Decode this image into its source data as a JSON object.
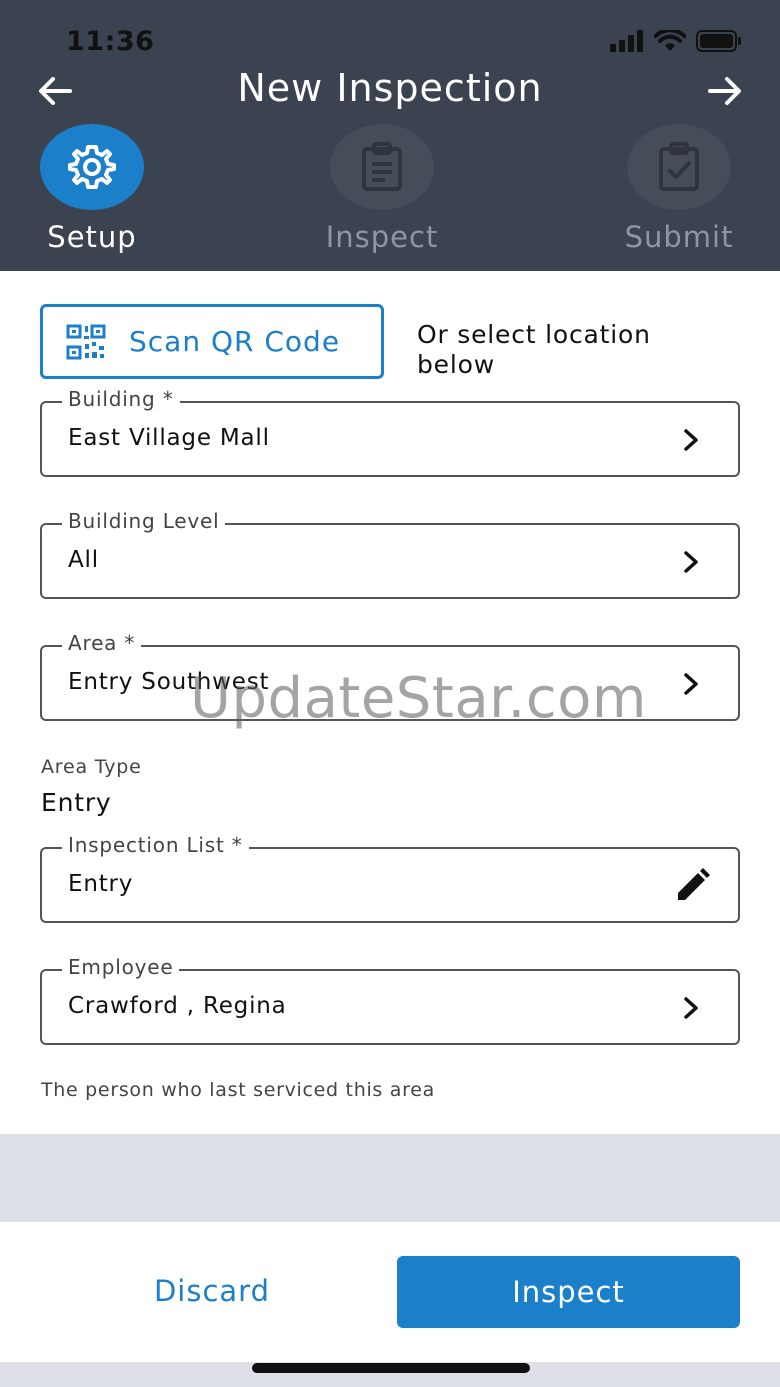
{
  "status_bar": {
    "time": "11:36"
  },
  "header": {
    "title": "New Inspection",
    "steps": [
      {
        "label": "Setup",
        "icon": "gear-icon",
        "state": "active"
      },
      {
        "label": "Inspect",
        "icon": "clipboard-list-icon",
        "state": "inactive"
      },
      {
        "label": "Submit",
        "icon": "clipboard-check-icon",
        "state": "inactive"
      }
    ]
  },
  "scan": {
    "label": "Scan QR Code",
    "or_text": "Or select location below"
  },
  "fields": {
    "building": {
      "legend": "Building *",
      "value": "East Village Mall"
    },
    "building_level": {
      "legend": "Building Level",
      "value": "All"
    },
    "area": {
      "legend": "Area *",
      "value": "Entry Southwest"
    },
    "inspection_list": {
      "legend": "Inspection List *",
      "value": "Entry"
    },
    "employee": {
      "legend": "Employee",
      "value": "Crawford , Regina"
    }
  },
  "area_type": {
    "label": "Area Type",
    "value": "Entry"
  },
  "employee_helper": "The person who last serviced this area",
  "watermark": "UpdateStar.com",
  "footer": {
    "discard_label": "Discard",
    "inspect_label": "Inspect"
  },
  "colors": {
    "accent": "#1b80c9",
    "header_bg": "#3b4250",
    "band_bg": "#dde1e7"
  }
}
